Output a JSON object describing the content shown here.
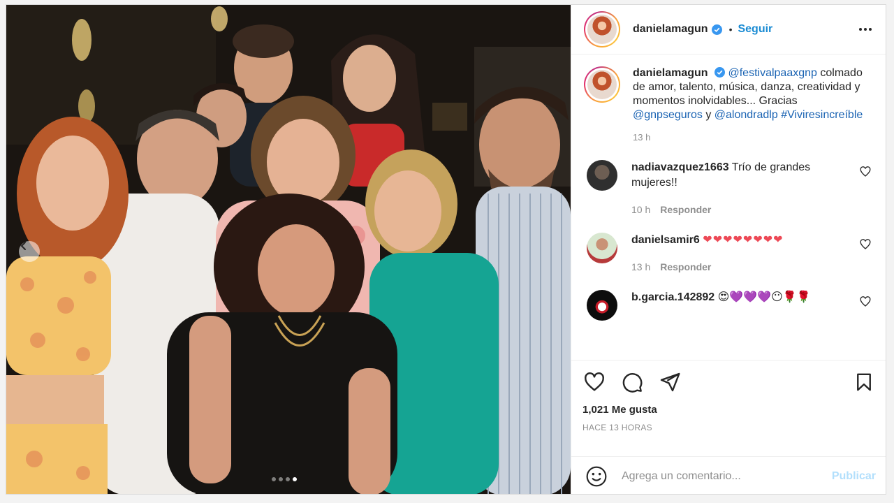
{
  "post": {
    "author": "danielamagun",
    "follow_label": "Seguir",
    "separator": "•",
    "caption_user": "danielamagun",
    "caption_mention_1": "@festivalpaaxgnp",
    "caption_text_1": "colmado de amor, talento, música, danza, creatividad y momentos inolvidables... Gracias",
    "caption_mention_2": "@gnpseguros",
    "caption_and": "y",
    "caption_mention_3": "@alondradlp",
    "caption_hashtag": "#Viviresincreíble",
    "caption_time": "13 h",
    "likes": "1,021 Me gusta",
    "posted_ago": "HACE 13 HORAS",
    "comment_placeholder": "Agrega un comentario...",
    "publish_label": "Publicar",
    "carousel": {
      "count": 4,
      "active_index": 3
    }
  },
  "comments": [
    {
      "user": "nadiavazquez1663",
      "text": "Trío de grandes mujeres!!",
      "time": "10 h",
      "reply": "Responder"
    },
    {
      "user": "danielsamir6",
      "text": "❤❤❤❤❤❤❤❤",
      "time": "13 h",
      "reply": "Responder"
    },
    {
      "user": "b.garcia.142892",
      "text": "😍💜💜💜😶🌹🌹"
    }
  ],
  "colors": {
    "follow_blue": "#1a8bd3",
    "link_blue": "#1a63b3",
    "heart_red": "#ed4956",
    "publish_disabled": "#b2dffc"
  },
  "icons": [
    "chevron-left-icon",
    "verified-badge-icon",
    "more-options-icon",
    "heart-icon",
    "comment-icon",
    "share-icon",
    "bookmark-icon",
    "emoji-icon"
  ]
}
